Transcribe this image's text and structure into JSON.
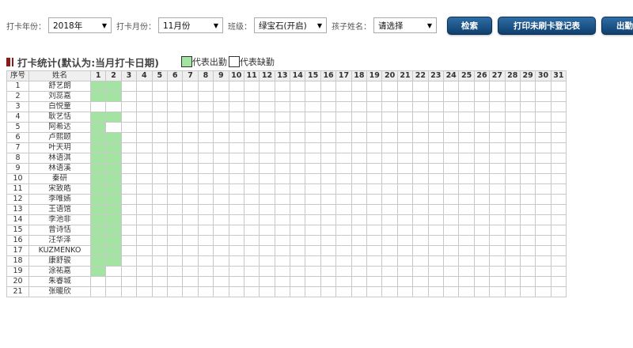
{
  "filters": {
    "year_label": "打卡年份：",
    "year_value": "2018年",
    "month_label": "打卡月份：",
    "month_value": "11月份",
    "class_label": "班级：",
    "class_value": "绿宝石(开启)",
    "child_label": "孩子姓名：",
    "child_value": "请选择"
  },
  "buttons": {
    "search": "检索",
    "print": "打印未刷卡登记表",
    "attendance": "出勤登记"
  },
  "header": {
    "title": "打卡统计(默认为:当月打卡日期)",
    "legend_present": "代表出勤",
    "legend_absent": "代表缺勤"
  },
  "table": {
    "col_index": "序号",
    "col_name": "姓名",
    "days": [
      "1",
      "2",
      "3",
      "4",
      "5",
      "6",
      "7",
      "8",
      "9",
      "10",
      "11",
      "12",
      "13",
      "14",
      "15",
      "16",
      "17",
      "18",
      "19",
      "20",
      "21",
      "22",
      "23",
      "24",
      "25",
      "26",
      "27",
      "28",
      "29",
      "30",
      "31"
    ],
    "rows": [
      {
        "no": "1",
        "name": "舒艺朗",
        "attendance": [
          1,
          1
        ]
      },
      {
        "no": "2",
        "name": "刘蕊嘉",
        "attendance": [
          1,
          1
        ]
      },
      {
        "no": "3",
        "name": "白悦童",
        "attendance": [
          0,
          0
        ]
      },
      {
        "no": "4",
        "name": "耿艺恬",
        "attendance": [
          1,
          1
        ]
      },
      {
        "no": "5",
        "name": "阿希达",
        "attendance": [
          1,
          0
        ]
      },
      {
        "no": "6",
        "name": "卢熙颐",
        "attendance": [
          1,
          1
        ]
      },
      {
        "no": "7",
        "name": "叶天玥",
        "attendance": [
          1,
          1
        ]
      },
      {
        "no": "8",
        "name": "林语淇",
        "attendance": [
          1,
          1
        ]
      },
      {
        "no": "9",
        "name": "林语溪",
        "attendance": [
          1,
          1
        ]
      },
      {
        "no": "10",
        "name": "秦研",
        "attendance": [
          1,
          1
        ]
      },
      {
        "no": "11",
        "name": "宋致皓",
        "attendance": [
          1,
          1
        ]
      },
      {
        "no": "12",
        "name": "李唯嫣",
        "attendance": [
          1,
          1
        ]
      },
      {
        "no": "13",
        "name": "王语馆",
        "attendance": [
          1,
          1
        ]
      },
      {
        "no": "14",
        "name": "李池非",
        "attendance": [
          1,
          1
        ]
      },
      {
        "no": "15",
        "name": "曾诗恬",
        "attendance": [
          1,
          1
        ]
      },
      {
        "no": "16",
        "name": "汪华泽",
        "attendance": [
          1,
          1
        ]
      },
      {
        "no": "17",
        "name": "KUZMENKO",
        "attendance": [
          1,
          1
        ]
      },
      {
        "no": "18",
        "name": "康舒骏",
        "attendance": [
          1,
          1
        ]
      },
      {
        "no": "19",
        "name": "涂祐嘉",
        "attendance": [
          1,
          0
        ]
      },
      {
        "no": "20",
        "name": "朱睿城",
        "attendance": [
          0,
          0
        ]
      },
      {
        "no": "21",
        "name": "张暖欣",
        "attendance": [
          0,
          0
        ]
      }
    ]
  },
  "colors": {
    "present": "#a3e4a3",
    "button": "#1c4f84"
  }
}
